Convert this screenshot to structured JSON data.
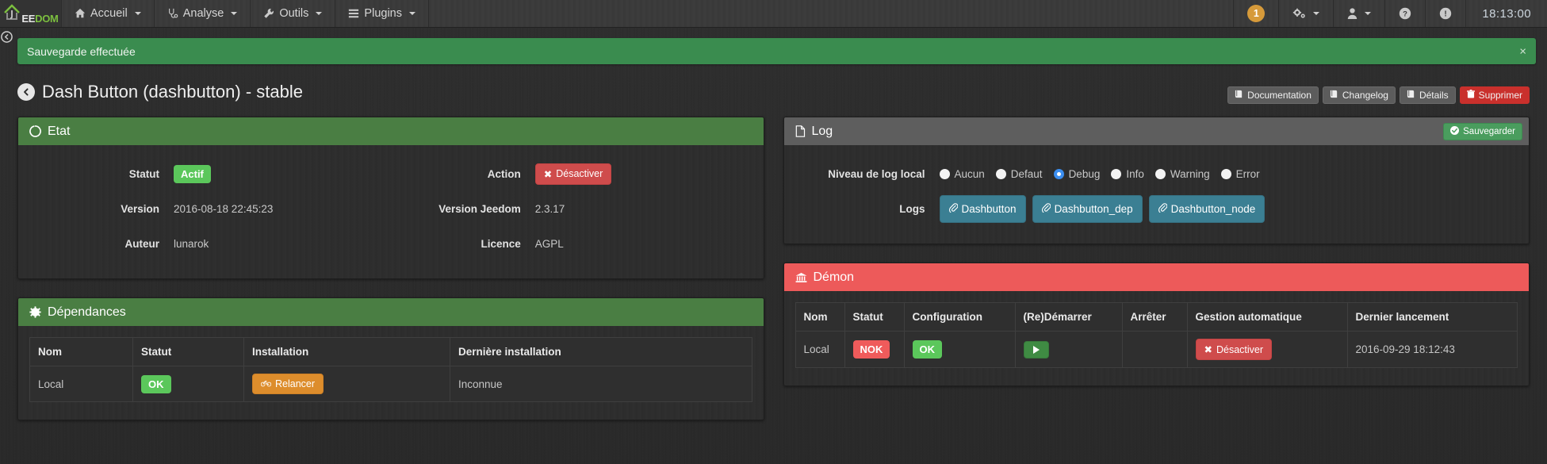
{
  "navbar": {
    "brand": {
      "ee": "EE",
      "dom": "DOM",
      "logo_icon": "jeedom-house-logo"
    },
    "items": [
      {
        "label": "Accueil",
        "icon": "home-icon",
        "caret": true
      },
      {
        "label": "Analyse",
        "icon": "stethoscope-icon",
        "caret": true
      },
      {
        "label": "Outils",
        "icon": "wrench-icon",
        "caret": true
      },
      {
        "label": "Plugins",
        "icon": "list-icon",
        "caret": true
      }
    ],
    "right": {
      "badge_count": "1",
      "gear_icon": "gears-icon",
      "user_icon": "user-icon",
      "help_icon": "question-circle-icon",
      "info_icon": "exclamation-circle-icon",
      "time": "18:13:00"
    }
  },
  "sidebar_toggle_icon": "chevron-circle-left-icon",
  "alert": {
    "message": "Sauvegarde effectuée",
    "close_label": "×",
    "color": "#3a8c4f"
  },
  "page": {
    "back_icon": "arrow-circle-left-icon",
    "title": "Dash Button (dashbutton) - stable",
    "actions": [
      {
        "label": "Documentation",
        "icon": "book-icon",
        "style": "default"
      },
      {
        "label": "Changelog",
        "icon": "book-icon",
        "style": "default"
      },
      {
        "label": "Détails",
        "icon": "book-icon",
        "style": "default"
      },
      {
        "label": "Supprimer",
        "icon": "trash-icon",
        "style": "danger"
      }
    ]
  },
  "etat": {
    "title": "Etat",
    "icon": "circle-notch-icon",
    "header_color": "#4a7e43",
    "rows": [
      {
        "label": "Statut",
        "value": "Actif",
        "type": "badge-green",
        "label2": "Action",
        "value2": "Désactiver",
        "type2": "btn-danger",
        "icon2": "times-icon"
      },
      {
        "label": "Version",
        "value": "2016-08-18 22:45:23",
        "type": "text",
        "label2": "Version Jeedom",
        "value2": "2.3.17",
        "type2": "text"
      },
      {
        "label": "Auteur",
        "value": "lunarok",
        "type": "text",
        "label2": "Licence",
        "value2": "AGPL",
        "type2": "text"
      }
    ]
  },
  "log": {
    "title": "Log",
    "icon": "file-icon",
    "header_color": "#5e5e5e",
    "save_label": "Sauvegarder",
    "save_icon": "check-circle-icon",
    "level_label": "Niveau de log local",
    "levels": [
      {
        "label": "Aucun",
        "checked": false
      },
      {
        "label": "Defaut",
        "checked": false
      },
      {
        "label": "Debug",
        "checked": true
      },
      {
        "label": "Info",
        "checked": false
      },
      {
        "label": "Warning",
        "checked": false
      },
      {
        "label": "Error",
        "checked": false
      }
    ],
    "logs_label": "Logs",
    "log_buttons": [
      {
        "label": "Dashbutton",
        "icon": "paperclip-icon"
      },
      {
        "label": "Dashbutton_dep",
        "icon": "paperclip-icon"
      },
      {
        "label": "Dashbutton_node",
        "icon": "paperclip-icon"
      }
    ]
  },
  "dependances": {
    "title": "Dépendances",
    "icon": "cog-icon",
    "header_color": "#4a7e43",
    "columns": [
      "Nom",
      "Statut",
      "Installation",
      "Dernière installation"
    ],
    "rows": [
      {
        "nom": "Local",
        "statut": "OK",
        "statut_type": "badge-green",
        "installation": "Relancer",
        "installation_icon": "bicycle-icon",
        "derniere": "Inconnue"
      }
    ]
  },
  "demon": {
    "title": "Démon",
    "icon": "bank-icon",
    "header_color": "#ed5a5a",
    "columns": [
      "Nom",
      "Statut",
      "Configuration",
      "(Re)Démarrer",
      "Arrêter",
      "Gestion automatique",
      "Dernier lancement"
    ],
    "rows": [
      {
        "nom": "Local",
        "statut": "NOK",
        "statut_type": "badge-red",
        "configuration": "OK",
        "configuration_type": "badge-green",
        "redemarrer_icon": "play-icon",
        "arreter": "",
        "gestion": "Désactiver",
        "gestion_icon": "times-icon",
        "dernier_lancement": "2016-09-29 18:12:43"
      }
    ]
  }
}
